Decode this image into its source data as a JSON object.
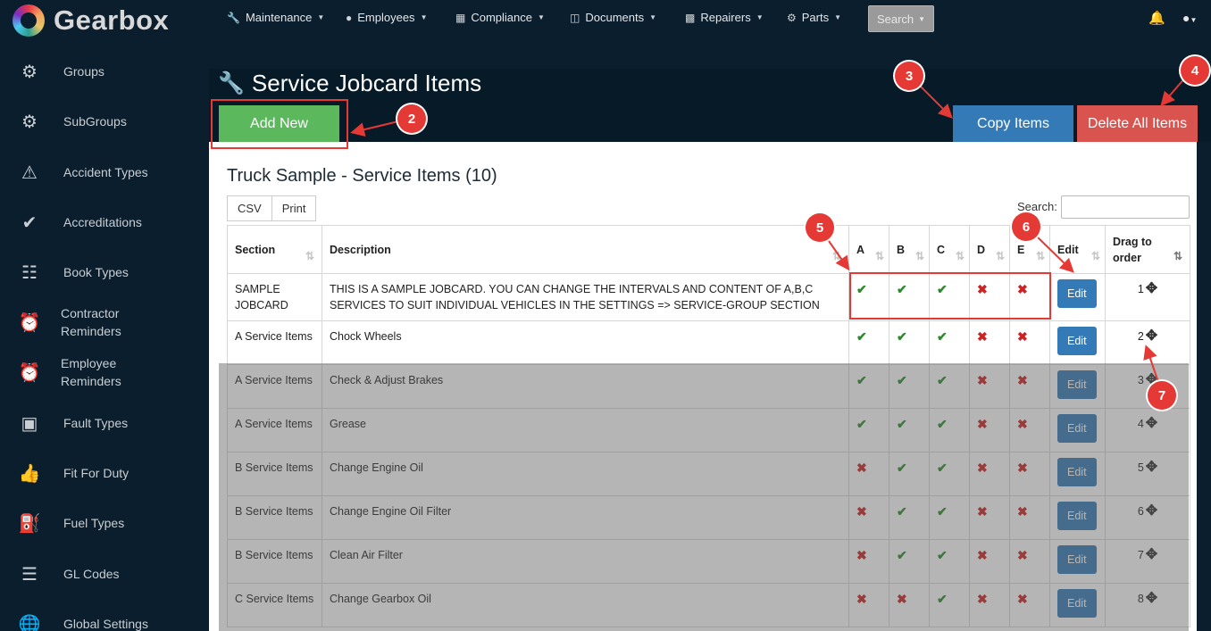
{
  "brand": {
    "name": "Gearbox"
  },
  "nav": {
    "items": [
      {
        "label": "Maintenance",
        "icon": "wrench-icon"
      },
      {
        "label": "Employees",
        "icon": "user-icon"
      },
      {
        "label": "Compliance",
        "icon": "calendar-icon"
      },
      {
        "label": "Documents",
        "icon": "folder-icon"
      },
      {
        "label": "Repairers",
        "icon": "address-book-icon"
      },
      {
        "label": "Parts",
        "icon": "gear-icon"
      }
    ],
    "search_label": "Search"
  },
  "sidebar": {
    "items": [
      {
        "label": "Groups",
        "icon": "gears-icon"
      },
      {
        "label": "SubGroups",
        "icon": "gears-icon"
      },
      {
        "label": "Accident Types",
        "icon": "warning-icon"
      },
      {
        "label": "Accreditations",
        "icon": "check-icon"
      },
      {
        "label": "Book Types",
        "icon": "books-icon"
      },
      {
        "label": "Contractor Reminders",
        "icon": "alarm-clock-icon"
      },
      {
        "label": "Employee Reminders",
        "icon": "alarm-clock-icon"
      },
      {
        "label": "Fault Types",
        "icon": "truck-fault-icon"
      },
      {
        "label": "Fit For Duty",
        "icon": "thumbs-up-icon"
      },
      {
        "label": "Fuel Types",
        "icon": "fuel-pump-icon"
      },
      {
        "label": "GL Codes",
        "icon": "list-icon"
      },
      {
        "label": "Global Settings",
        "icon": "globe-icon"
      }
    ]
  },
  "page": {
    "title": "Service Jobcard Items",
    "add_new": "Add New",
    "copy_items": "Copy Items",
    "delete_all": "Delete All Items",
    "section_title": "Truck Sample - Service Items (10)",
    "csv": "CSV",
    "print": "Print",
    "search_label": "Search:"
  },
  "table": {
    "headers": [
      "Section",
      "Description",
      "A",
      "B",
      "C",
      "D",
      "E",
      "Edit",
      "Drag to order"
    ],
    "edit_label": "Edit",
    "rows": [
      {
        "section": "SAMPLE JOBCARD",
        "description": "THIS IS A SAMPLE JOBCARD. YOU CAN CHANGE THE INTERVALS AND CONTENT OF A,B,C SERVICES TO SUIT INDIVIDUAL VEHICLES IN THE SETTINGS => SERVICE-GROUP SECTION",
        "flags": [
          true,
          true,
          true,
          false,
          false
        ],
        "order": "1"
      },
      {
        "section": "A Service Items",
        "description": "Chock Wheels",
        "flags": [
          true,
          true,
          true,
          false,
          false
        ],
        "order": "2"
      },
      {
        "section": "A Service Items",
        "description": "Check & Adjust Brakes",
        "flags": [
          true,
          true,
          true,
          false,
          false
        ],
        "order": "3"
      },
      {
        "section": "A Service Items",
        "description": "Grease",
        "flags": [
          true,
          true,
          true,
          false,
          false
        ],
        "order": "4"
      },
      {
        "section": "B Service Items",
        "description": "Change Engine Oil",
        "flags": [
          false,
          true,
          true,
          false,
          false
        ],
        "order": "5"
      },
      {
        "section": "B Service Items",
        "description": "Change Engine Oil Filter",
        "flags": [
          false,
          true,
          true,
          false,
          false
        ],
        "order": "6"
      },
      {
        "section": "B Service Items",
        "description": "Clean Air Filter",
        "flags": [
          false,
          true,
          true,
          false,
          false
        ],
        "order": "7"
      },
      {
        "section": "C Service Items",
        "description": "Change Gearbox Oil",
        "flags": [
          false,
          false,
          true,
          false,
          false
        ],
        "order": "8"
      }
    ]
  },
  "annotations": [
    "2",
    "3",
    "4",
    "5",
    "6",
    "7"
  ],
  "colors": {
    "accent_green": "#5cb85c",
    "accent_blue": "#337ab7",
    "accent_red": "#d9534f",
    "annotation_red": "#e53935"
  }
}
